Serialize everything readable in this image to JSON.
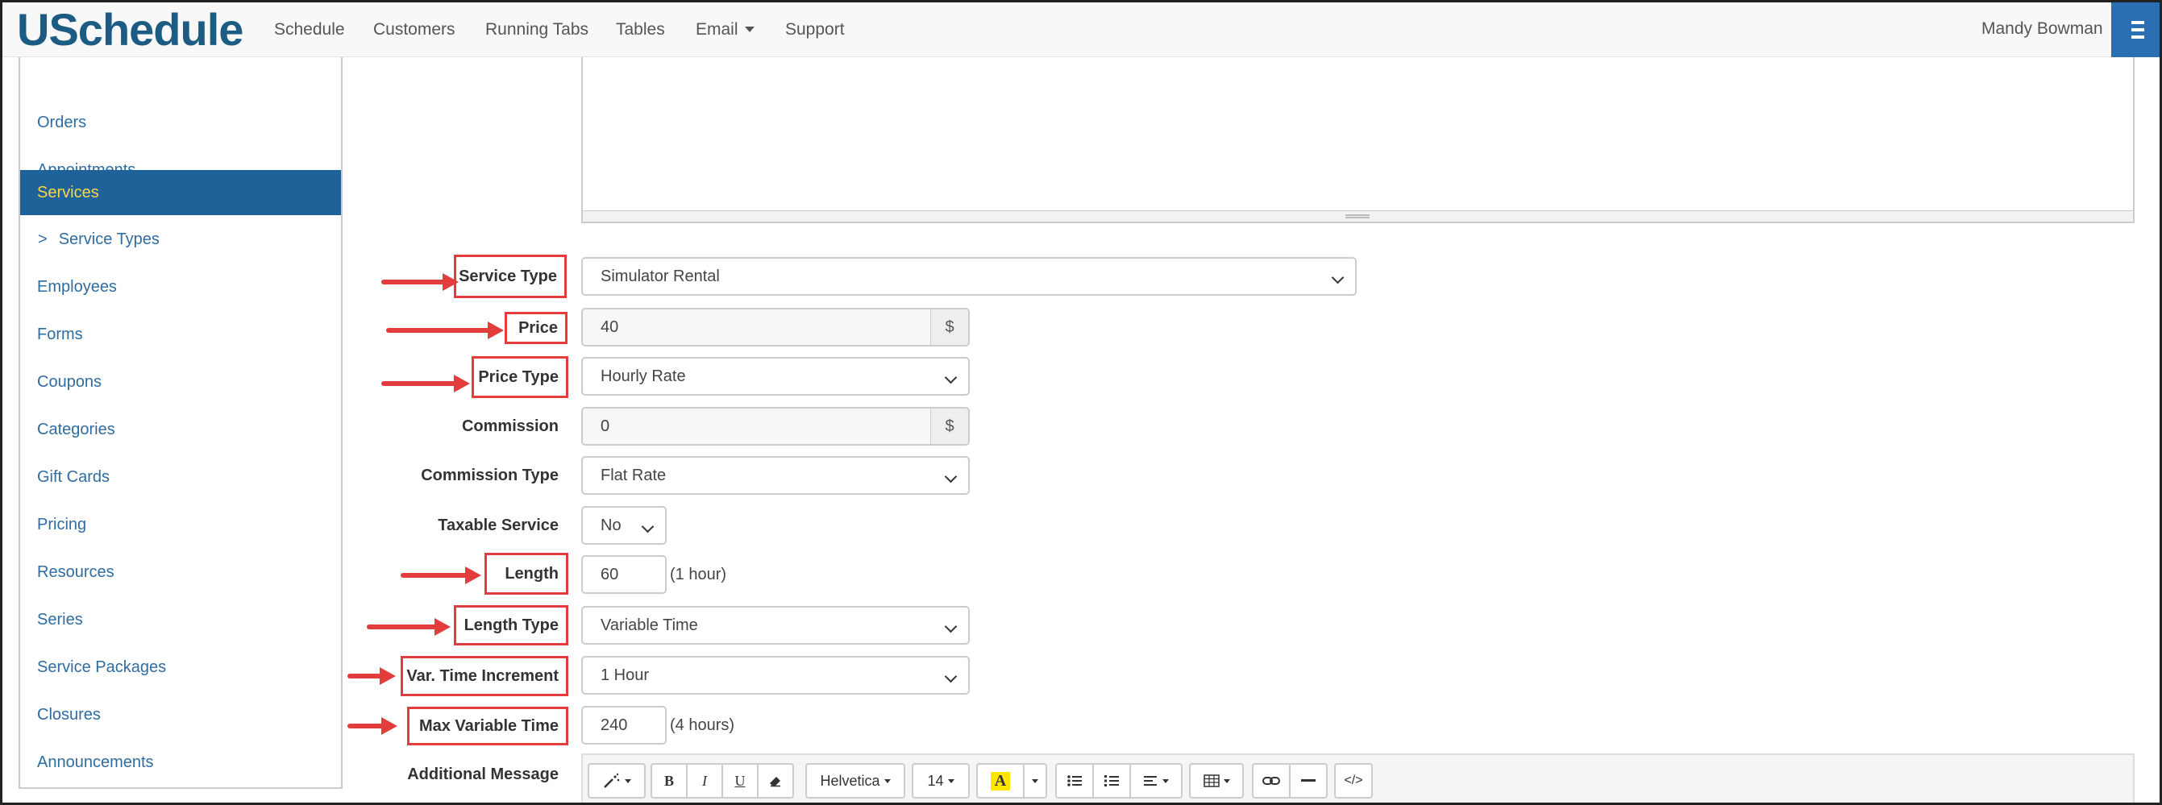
{
  "app": {
    "brand": "USchedule",
    "nav": [
      "Schedule",
      "Customers",
      "Running Tabs",
      "Tables",
      "Email",
      "Support"
    ],
    "user": "Mandy Bowman",
    "menu_icon": "hamburger-icon"
  },
  "sidebar": {
    "items": [
      {
        "label": "Orders"
      },
      {
        "label": "Appointments"
      },
      {
        "label": "Services",
        "active": true
      },
      {
        "label": "Service Types",
        "prefix": ">"
      },
      {
        "label": "Employees"
      },
      {
        "label": "Forms"
      },
      {
        "label": "Coupons"
      },
      {
        "label": "Categories"
      },
      {
        "label": "Gift Cards"
      },
      {
        "label": "Pricing"
      },
      {
        "label": "Resources"
      },
      {
        "label": "Series"
      },
      {
        "label": "Service Packages"
      },
      {
        "label": "Closures"
      },
      {
        "label": "Announcements"
      }
    ]
  },
  "form": {
    "service_type": {
      "label": "Service Type",
      "value": "Simulator Rental"
    },
    "price": {
      "label": "Price",
      "value": "40",
      "addon": "$"
    },
    "price_type": {
      "label": "Price Type",
      "value": "Hourly Rate"
    },
    "commission": {
      "label": "Commission",
      "value": "0",
      "addon": "$"
    },
    "commission_type": {
      "label": "Commission Type",
      "value": "Flat Rate"
    },
    "taxable_service": {
      "label": "Taxable Service",
      "value": "No"
    },
    "length": {
      "label": "Length",
      "value": "60",
      "help": "(1 hour)"
    },
    "length_type": {
      "label": "Length Type",
      "value": "Variable Time"
    },
    "var_time_increment": {
      "label": "Var. Time Increment",
      "value": "1 Hour"
    },
    "max_variable_time": {
      "label": "Max Variable Time",
      "value": "240",
      "help": "(4 hours)"
    },
    "additional_message": {
      "label": "Additional Message"
    }
  },
  "toolbar": {
    "font_name": "Helvetica",
    "font_size": "14",
    "bold": "B",
    "italic": "I",
    "underline": "U",
    "color_letter": "A",
    "code": "</>"
  },
  "colors": {
    "brand": "#1d5c82",
    "active_bg": "#1f6199",
    "active_text": "#f5d84a",
    "highlight": "#e23c3c",
    "menu_button": "#2a6fb4"
  }
}
